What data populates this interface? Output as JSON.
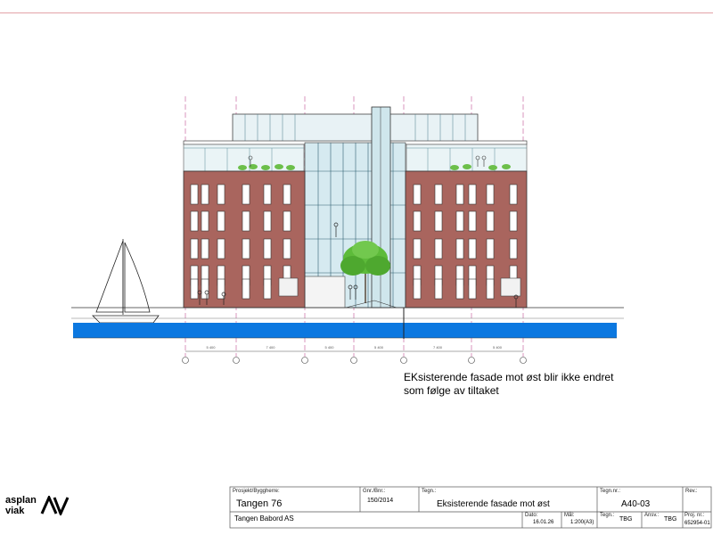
{
  "note": {
    "text": "EKsisterende fasade mot øst blir ikke endret\nsom følge av tiltaket"
  },
  "logo": {
    "line1": "asplan",
    "line2": "viak"
  },
  "dimensions": [
    "5 400",
    "7 400",
    "5 400",
    "5 400",
    "7 400",
    "5 400"
  ],
  "title_block": {
    "project_label": "Prosjekt/Byggherre:",
    "project": "Tangen 76",
    "client": "Tangen Babord AS",
    "gnr_label": "Gnr./Bnr.:",
    "gnr": "150/2014",
    "drawing_label": "Tegn.:",
    "drawing_title": "Eksisterende fasade mot øst",
    "drawing_no_label": "Tegn.nr.:",
    "drawing_no": "A40-03",
    "rev_label": "Rev.:",
    "date_label": "Dato:",
    "date": "16.01.26",
    "scale_label": "Mål:",
    "scale": "1:200(A3)",
    "drawn_label": "Tegn.:",
    "drawn": "TBG",
    "resp_label": "Ansv.:",
    "resp": "TBG",
    "projno_label": "Proj. nr.:",
    "projno": "652954-01"
  },
  "colors": {
    "brick": "#a9655e",
    "glass": "#cfe6ec",
    "water": "#0c78e0",
    "tree": "#5dbb3a",
    "frame": "#e3a3a8"
  }
}
